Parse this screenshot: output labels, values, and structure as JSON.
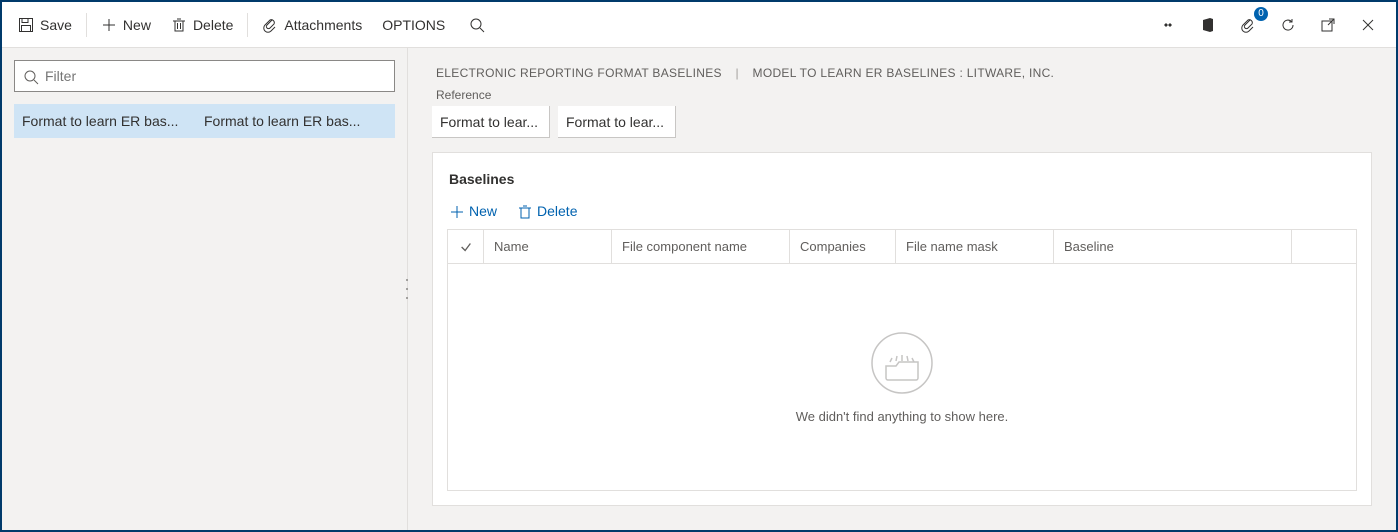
{
  "toolbar": {
    "save_label": "Save",
    "new_label": "New",
    "delete_label": "Delete",
    "attachments_label": "Attachments",
    "options_label": "OPTIONS"
  },
  "header_icons": {
    "badge_count": "0"
  },
  "left": {
    "filter_placeholder": "Filter",
    "row": {
      "col1": "Format to learn ER bas...",
      "col2": "Format to learn ER bas..."
    }
  },
  "breadcrumb": {
    "a": "ELECTRONIC REPORTING FORMAT BASELINES",
    "b": "MODEL TO LEARN ER BASELINES : LITWARE, INC."
  },
  "reference": {
    "label": "Reference",
    "cell1": "Format to lear...",
    "cell2": "Format to lear..."
  },
  "card": {
    "title": "Baselines",
    "new_label": "New",
    "delete_label": "Delete",
    "columns": {
      "name": "Name",
      "component": "File component name",
      "companies": "Companies",
      "mask": "File name mask",
      "baseline": "Baseline"
    },
    "empty_text": "We didn't find anything to show here."
  }
}
